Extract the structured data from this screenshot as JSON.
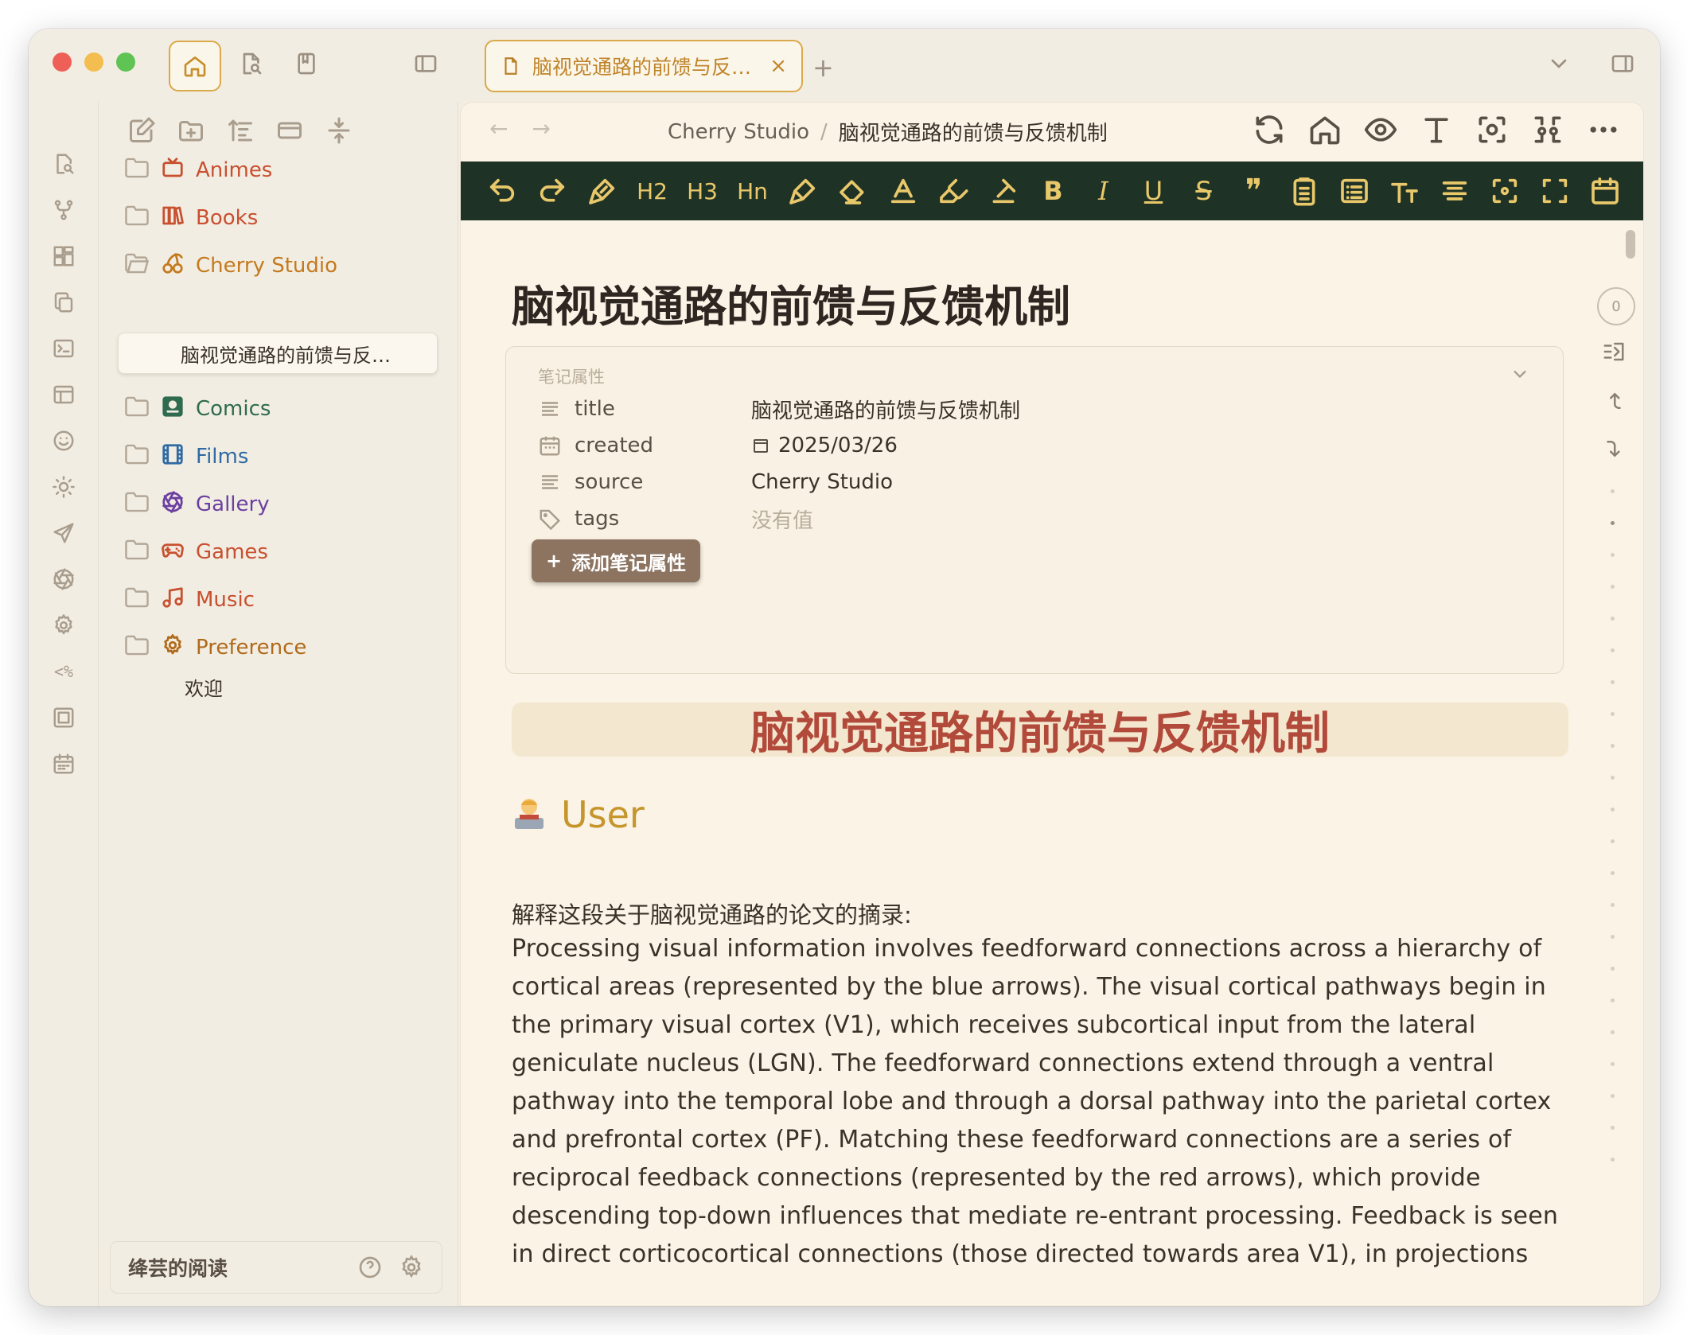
{
  "window": {
    "tab_title": "脑视觉通路的前馈与反…",
    "tab_close": "×",
    "tab_add": "+"
  },
  "sidebar": {
    "items": [
      {
        "label": "Animes",
        "color": "#c8502f",
        "icon": "tv-icon"
      },
      {
        "label": "Books",
        "color": "#c8502f",
        "icon": "books-icon"
      },
      {
        "label": "Cherry Studio",
        "color": "#c47a1e",
        "icon": "cherry-icon"
      },
      {
        "label": "Comics",
        "color": "#2f6b4e",
        "icon": "comic-icon"
      },
      {
        "label": "Films",
        "color": "#2f6aa3",
        "icon": "film-icon"
      },
      {
        "label": "Gallery",
        "color": "#6b3fa0",
        "icon": "aperture-icon"
      },
      {
        "label": "Games",
        "color": "#c8502f",
        "icon": "gamepad-icon"
      },
      {
        "label": "Music",
        "color": "#c8502f",
        "icon": "music-icon"
      },
      {
        "label": "Preference",
        "color": "#b06a1a",
        "icon": "gear-icon"
      }
    ],
    "active_note": "脑视觉通路的前馈与反…",
    "welcome_note": "欢迎",
    "library_name": "绛芸的阅读"
  },
  "main": {
    "breadcrumb": [
      "Cherry Studio",
      "/",
      "脑视觉通路的前馈与反馈机制"
    ],
    "nav_back": "←",
    "nav_forward": "→",
    "toolbar": {
      "h2": "H2",
      "h3": "H3",
      "hn": "Hn",
      "bold": "B",
      "italic": "I",
      "underline": "U",
      "strike": "S",
      "quote": "❞"
    },
    "title": "脑视觉通路的前馈与反馈机制",
    "properties": {
      "header": "笔记属性",
      "rows": [
        {
          "key": "title",
          "value": "脑视觉通路的前馈与反馈机制"
        },
        {
          "key": "created",
          "value": "2025/03/26"
        },
        {
          "key": "source",
          "value": "Cherry Studio"
        },
        {
          "key": "tags",
          "value": "没有值"
        }
      ],
      "add_button": "添加笔记属性",
      "add_plus": "+"
    },
    "h1_heading": "脑视觉通路的前馈与反馈机制",
    "user_heading": "User",
    "prompt_line": "解释这段关于脑视觉通路的论文的摘录:",
    "paragraph_lines": [
      "Processing visual information involves feedforward connections across a hierarchy of",
      "cortical areas (represented by the blue arrows). The visual cortical pathways begin in",
      "the primary visual cortex (V1), which receives subcortical input from the lateral",
      "geniculate nucleus (LGN). The feedforward connections extend through a ventral",
      "pathway into the temporal lobe and through a dorsal pathway into the parietal cortex",
      "and prefrontal cortex (PF). Matching these feedforward connections are a series of",
      "reciprocal feedback connections (represented by the red arrows), which provide",
      "descending top-down influences that mediate re-entrant processing. Feedback is seen",
      "in direct corticocortical connections (those directed towards area V1), in projections"
    ],
    "counter": "0"
  },
  "colors": {
    "accent": "#d9a94a",
    "toolbar_bg": "#1f3226",
    "toolbar_fg": "#e8c86a",
    "heading_red": "#b24a3b",
    "user_gold": "#c6952c"
  }
}
